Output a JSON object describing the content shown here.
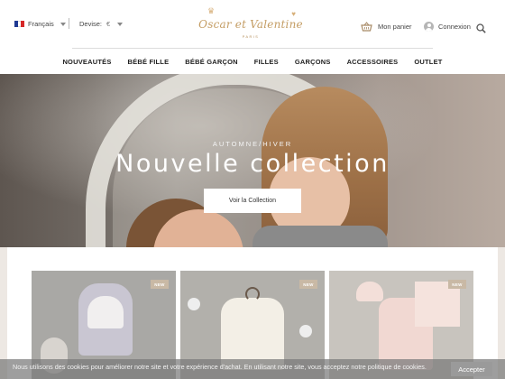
{
  "header": {
    "language": {
      "label": "Français",
      "flag_colors": [
        "#1f3a93",
        "#ffffff",
        "#d62828"
      ]
    },
    "currency": {
      "label": "Devise:",
      "value": "€"
    },
    "logo": {
      "brand": "Oscar et Valentine",
      "city": "PARIS",
      "color": "#c49d64"
    },
    "cart_label": "Mon panier",
    "login_label": "Connexion"
  },
  "nav": {
    "items": [
      {
        "label": "NOUVEAUTÉS"
      },
      {
        "label": "BÉBÉ FILLE"
      },
      {
        "label": "BÉBÉ GARÇON"
      },
      {
        "label": "FILLES"
      },
      {
        "label": "GARÇONS"
      },
      {
        "label": "ACCESSOIRES"
      },
      {
        "label": "OUTLET"
      }
    ]
  },
  "hero": {
    "subtitle": "AUTOMNE/HIVER",
    "title": "Nouvelle collection",
    "button_label": "Voir la Collection"
  },
  "products": [
    {
      "badge": "NEW"
    },
    {
      "badge": "NEW"
    },
    {
      "badge": "NEW"
    }
  ],
  "cookie_bar": {
    "text": "Nous utilisons des cookies pour améliorer notre site et votre expérience d'achat. En utilisant notre site, vous acceptez notre politique de cookies.",
    "accept_label": "Accepter"
  }
}
